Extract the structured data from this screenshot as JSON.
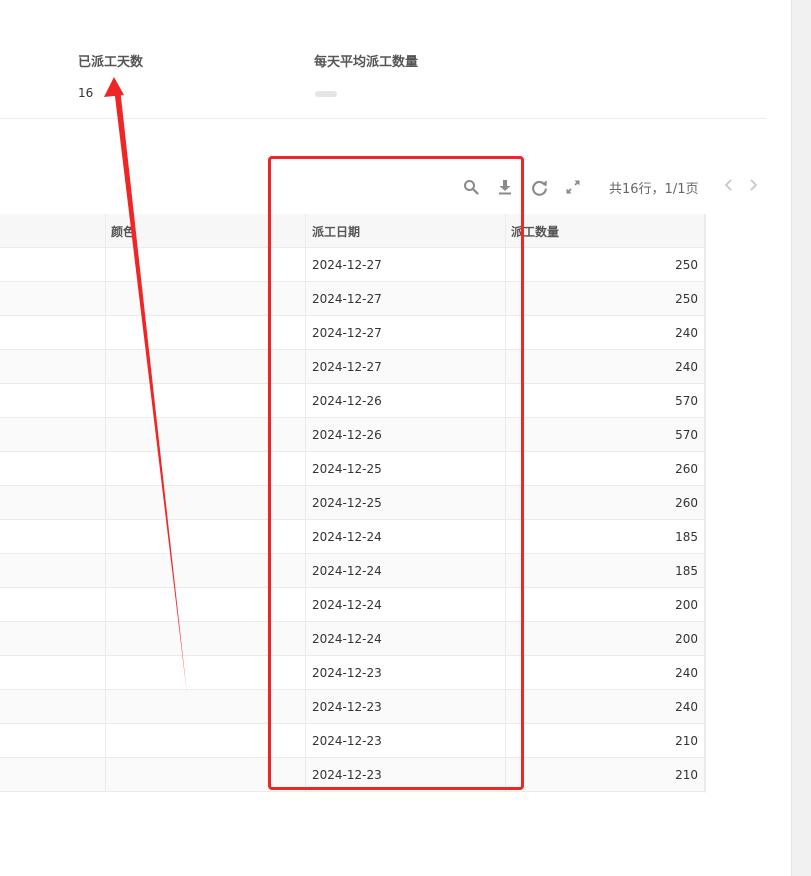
{
  "stats": {
    "days": {
      "label": "已派工天数",
      "value": "16"
    },
    "avg": {
      "label": "每天平均派工数量"
    }
  },
  "toolbar": {
    "icons": [
      "search-icon",
      "download-icon",
      "refresh-icon",
      "fullscreen-icon"
    ],
    "pager_text": "共16行，1/1页"
  },
  "table": {
    "headers": [
      "",
      "颜色",
      "派工日期",
      "派工数量"
    ],
    "rows": [
      {
        "date": "2024-12-27",
        "qty": "250"
      },
      {
        "date": "2024-12-27",
        "qty": "250"
      },
      {
        "date": "2024-12-27",
        "qty": "240"
      },
      {
        "date": "2024-12-27",
        "qty": "240"
      },
      {
        "date": "2024-12-26",
        "qty": "570"
      },
      {
        "date": "2024-12-26",
        "qty": "570"
      },
      {
        "date": "2024-12-25",
        "qty": "260"
      },
      {
        "date": "2024-12-25",
        "qty": "260"
      },
      {
        "date": "2024-12-24",
        "qty": "185"
      },
      {
        "date": "2024-12-24",
        "qty": "185"
      },
      {
        "date": "2024-12-24",
        "qty": "200"
      },
      {
        "date": "2024-12-24",
        "qty": "200"
      },
      {
        "date": "2024-12-23",
        "qty": "240"
      },
      {
        "date": "2024-12-23",
        "qty": "240"
      },
      {
        "date": "2024-12-23",
        "qty": "210"
      },
      {
        "date": "2024-12-23",
        "qty": "210"
      }
    ]
  },
  "annotation": {
    "color": "#f02626"
  }
}
